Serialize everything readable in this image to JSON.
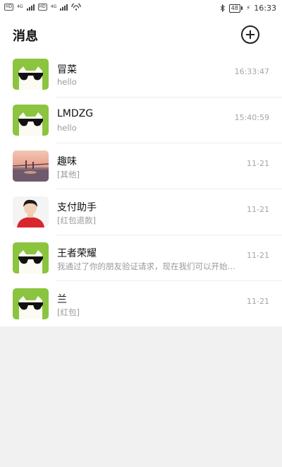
{
  "status_bar": {
    "hd1": "HD",
    "net1": "4G",
    "hd2": "HD",
    "net2": "4G",
    "battery": "48",
    "time": "16:33"
  },
  "header": {
    "title": "消息"
  },
  "conversations": [
    {
      "name": "冒菜",
      "preview": "hello",
      "time": "16:33:47",
      "avatar": "sunglasses-cat-avatar"
    },
    {
      "name": "LMDZG",
      "preview": "hello",
      "time": "15:40:59",
      "avatar": "sunglasses-cat-avatar"
    },
    {
      "name": "趣味",
      "preview": "[其他]",
      "time": "11-21",
      "avatar": "sunset-photo-avatar"
    },
    {
      "name": "支付助手",
      "preview": "[红包退款]",
      "time": "11-21",
      "avatar": "person-red-shirt-avatar"
    },
    {
      "name": "王者荣耀",
      "preview": "我通过了你的朋友验证请求，现在我们可以开始聊天了",
      "time": "11-21",
      "avatar": "sunglasses-cat-avatar"
    },
    {
      "name": "兰",
      "preview": "[红包]",
      "time": "11-21",
      "avatar": "sunglasses-cat-avatar"
    }
  ],
  "colors": {
    "accent_green": "#8bc53f",
    "divider": "#ececec",
    "background": "#f1f1f1"
  }
}
